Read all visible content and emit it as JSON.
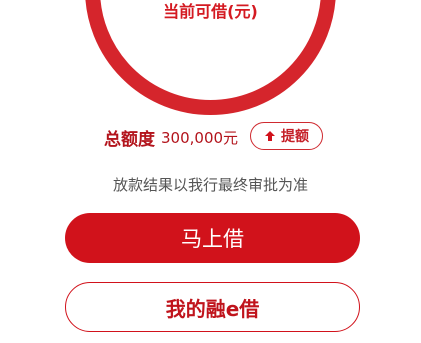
{
  "quota_circle": {
    "label": "当前可借(元)"
  },
  "total_limit": {
    "label": "总额度",
    "amount": "300,000元"
  },
  "raise_button": {
    "label": "提额",
    "icon": "arrow-up-icon"
  },
  "notice": "放款结果以我行最终审批为准",
  "actions": {
    "borrow_now": "马上借",
    "my_loans": "我的融e借"
  },
  "colors": {
    "brand_red": "#d1121b",
    "ring_red": "#d5252c",
    "text_gray": "#555555"
  }
}
